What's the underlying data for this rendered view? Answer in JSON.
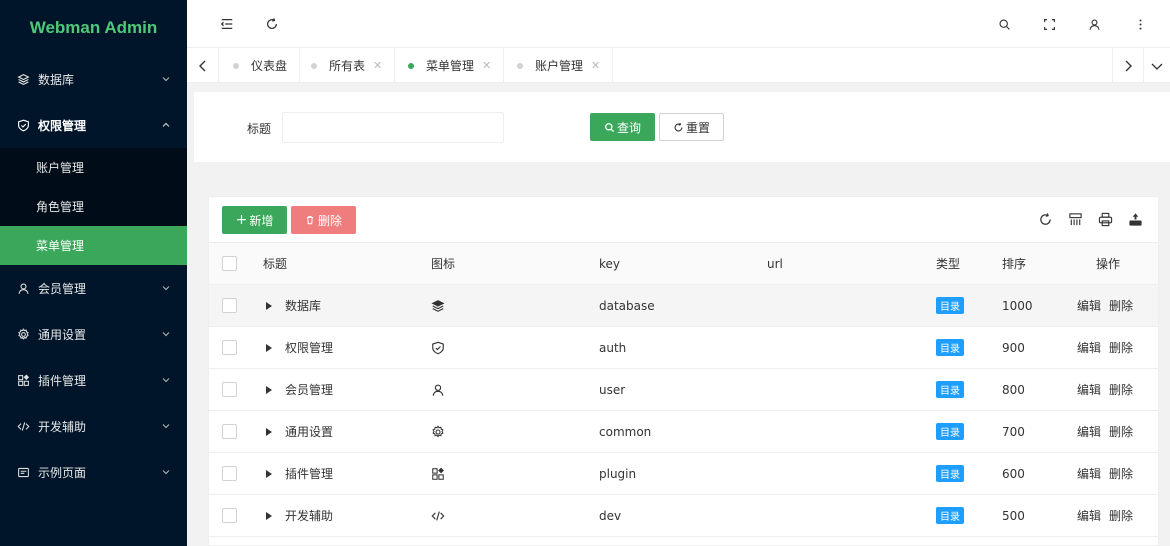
{
  "app": {
    "title": "Webman Admin"
  },
  "sidebar": {
    "items": [
      {
        "label": "数据库",
        "icon": "layers-icon",
        "expanded": false
      },
      {
        "label": "权限管理",
        "icon": "shield-icon",
        "expanded": true,
        "children": [
          {
            "label": "账户管理",
            "active": false
          },
          {
            "label": "角色管理",
            "active": false
          },
          {
            "label": "菜单管理",
            "active": true
          }
        ]
      },
      {
        "label": "会员管理",
        "icon": "user-icon",
        "expanded": false
      },
      {
        "label": "通用设置",
        "icon": "gear-icon",
        "expanded": false
      },
      {
        "label": "插件管理",
        "icon": "plugin-icon",
        "expanded": false
      },
      {
        "label": "开发辅助",
        "icon": "code-icon",
        "expanded": false
      },
      {
        "label": "示例页面",
        "icon": "page-icon",
        "expanded": false
      }
    ]
  },
  "tabs": [
    {
      "label": "仪表盘",
      "closable": false,
      "active": false
    },
    {
      "label": "所有表",
      "closable": true,
      "active": false
    },
    {
      "label": "菜单管理",
      "closable": true,
      "active": true
    },
    {
      "label": "账户管理",
      "closable": true,
      "active": false
    }
  ],
  "search": {
    "title_label": "标题",
    "title_value": "",
    "query_label": "查询",
    "reset_label": "重置"
  },
  "toolbar": {
    "add_label": "新增",
    "delete_label": "删除"
  },
  "table": {
    "headers": {
      "title": "标题",
      "icon": "图标",
      "key": "key",
      "url": "url",
      "type": "类型",
      "sort": "排序",
      "ops": "操作"
    },
    "edit_label": "编辑",
    "delete_label": "删除",
    "rows": [
      {
        "title": "数据库",
        "icon": "layers-icon",
        "key": "database",
        "url": "",
        "type": "目录",
        "sort": "1000"
      },
      {
        "title": "权限管理",
        "icon": "shield-icon",
        "key": "auth",
        "url": "",
        "type": "目录",
        "sort": "900"
      },
      {
        "title": "会员管理",
        "icon": "user-icon",
        "key": "user",
        "url": "",
        "type": "目录",
        "sort": "800"
      },
      {
        "title": "通用设置",
        "icon": "gear-icon",
        "key": "common",
        "url": "",
        "type": "目录",
        "sort": "700"
      },
      {
        "title": "插件管理",
        "icon": "plugin-icon",
        "key": "plugin",
        "url": "",
        "type": "目录",
        "sort": "600"
      },
      {
        "title": "开发辅助",
        "icon": "code-icon",
        "key": "dev",
        "url": "",
        "type": "目录",
        "sort": "500"
      }
    ]
  },
  "colors": {
    "sidebar_bg": "#001529",
    "accent": "#3aa75b",
    "danger": "#f07d7d",
    "badge": "#1e9fff"
  }
}
